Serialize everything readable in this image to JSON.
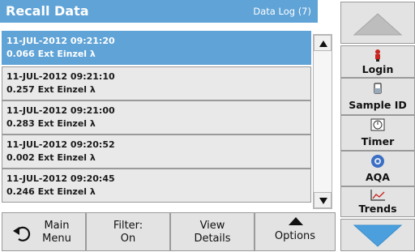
{
  "header": {
    "title": "Recall Data",
    "badge": "Data Log (7)"
  },
  "records": [
    {
      "datetime": "11-JUL-2012  09:21:20",
      "value_line": "0.066  Ext  Einzel λ",
      "selected": true
    },
    {
      "datetime": "11-JUL-2012  09:21:10",
      "value_line": "0.257  Ext  Einzel λ",
      "selected": false
    },
    {
      "datetime": "11-JUL-2012  09:21:00",
      "value_line": "0.283  Ext  Einzel λ",
      "selected": false
    },
    {
      "datetime": "11-JUL-2012  09:20:52",
      "value_line": "0.002  Ext  Einzel λ",
      "selected": false
    },
    {
      "datetime": "11-JUL-2012  09:20:45",
      "value_line": "0.246  Ext  Einzel λ",
      "selected": false
    }
  ],
  "bottom": {
    "main_menu": [
      "Main",
      "Menu"
    ],
    "filter": [
      "Filter:",
      "On"
    ],
    "view_details": [
      "View",
      "Details"
    ],
    "options": "Options"
  },
  "side": {
    "login": "Login",
    "sample_id": "Sample ID",
    "timer": "Timer",
    "aqa": "AQA",
    "trends": "Trends"
  },
  "colors": {
    "accent": "#5fa3d7",
    "button": "#e3e3e3",
    "arrow_blue": "#4a9fdc"
  }
}
